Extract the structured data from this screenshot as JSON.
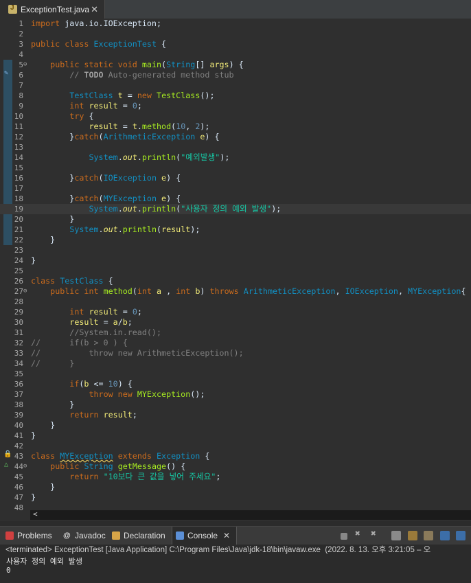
{
  "editor_tab": {
    "title": "ExceptionTest.java",
    "close": "✕"
  },
  "code_lines": [
    {
      "n": "1",
      "h": "<span class='kw'>import</span> java.io.IOException;"
    },
    {
      "n": "2",
      "h": ""
    },
    {
      "n": "3",
      "h": "<span class='kw'>public class</span> <span class='ty'>ExceptionTest</span> {"
    },
    {
      "n": "4",
      "h": ""
    },
    {
      "n": "5",
      "h": "    <span class='kw'>public static void</span> <span class='fn'>main</span>(<span class='ty'>String</span>[] <span class='va'>args</span>) {"
    },
    {
      "n": "6",
      "h": "        <span class='cm'>// <span class='todo'>TODO</span> Auto-generated method stub</span>"
    },
    {
      "n": "7",
      "h": ""
    },
    {
      "n": "8",
      "h": "        <span class='ty'>TestClass</span> <span class='va'>t</span> = <span class='kw'>new</span> <span class='fn'>TestClass</span>();"
    },
    {
      "n": "9",
      "h": "        <span class='kw'>int</span> <span class='va'>result</span> = <span class='nu'>0</span>;"
    },
    {
      "n": "10",
      "h": "        <span class='kw'>try</span> {"
    },
    {
      "n": "11",
      "h": "            <span class='va'>result</span> = <span class='va'>t</span>.<span class='fn'>method</span>(<span class='nu'>10</span>, <span class='nu'>2</span>);"
    },
    {
      "n": "12",
      "h": "        }<span class='kw'>catch</span>(<span class='ty'>ArithmeticException</span> <span class='va'>e</span>) {"
    },
    {
      "n": "13",
      "h": ""
    },
    {
      "n": "14",
      "h": "            <span class='ty'>System</span>.<i class='va'>out</i>.<span class='fn'>println</span>(<span class='st'>\"예외발생\"</span>);"
    },
    {
      "n": "15",
      "h": ""
    },
    {
      "n": "16",
      "h": "        }<span class='kw'>catch</span>(<span class='ty'>IOException</span> <span class='va'>e</span>) {"
    },
    {
      "n": "17",
      "h": ""
    },
    {
      "n": "18",
      "h": "        }<span class='kw'>catch</span>(<span class='ty'>MYException</span> <span class='va'>e</span>) {"
    },
    {
      "n": "19",
      "h": "            <span class='ty'>System</span>.<i class='va'>out</i>.<span class='fn'>println</span>(<span class='st'>\"사용자 정의 예외 발생\"</span>);"
    },
    {
      "n": "20",
      "h": "        }"
    },
    {
      "n": "21",
      "h": "        <span class='ty'>System</span>.<i class='va'>out</i>.<span class='fn'>println</span>(<span class='va'>result</span>);"
    },
    {
      "n": "22",
      "h": "    }"
    },
    {
      "n": "23",
      "h": ""
    },
    {
      "n": "24",
      "h": "}"
    },
    {
      "n": "25",
      "h": ""
    },
    {
      "n": "26",
      "h": "<span class='kw'>class</span> <span class='ty'>TestClass</span> {"
    },
    {
      "n": "27",
      "h": "    <span class='kw'>public int</span> <span class='fn'>method</span>(<span class='kw'>int</span> <span class='va'>a</span> , <span class='kw'>int</span> <span class='va'>b</span>) <span class='kw'>throws</span> <span class='ty'>ArithmeticException</span>, <span class='ty'>IOException</span>, <span class='ty'>MYException</span>{"
    },
    {
      "n": "28",
      "h": ""
    },
    {
      "n": "29",
      "h": "        <span class='kw'>int</span> <span class='va'>result</span> = <span class='nu'>0</span>;"
    },
    {
      "n": "30",
      "h": "        <span class='va'>result</span> = <span class='va'>a</span>/<span class='va'>b</span>;"
    },
    {
      "n": "31",
      "h": "        <span class='cm'>//System.in.read();</span>"
    },
    {
      "n": "32",
      "h": "<span class='cm'>//      if(b &gt; 0 ) {</span>"
    },
    {
      "n": "33",
      "h": "<span class='cm'>//          throw new ArithmeticException();</span>"
    },
    {
      "n": "34",
      "h": "<span class='cm'>//      }</span>"
    },
    {
      "n": "35",
      "h": ""
    },
    {
      "n": "36",
      "h": "        <span class='kw'>if</span>(<span class='va'>b</span> &lt;= <span class='nu'>10</span>) {"
    },
    {
      "n": "37",
      "h": "            <span class='kw'>throw new</span> <span class='fn'>MYException</span>();"
    },
    {
      "n": "38",
      "h": "        }"
    },
    {
      "n": "39",
      "h": "        <span class='kw'>return</span> <span class='va'>result</span>;"
    },
    {
      "n": "40",
      "h": "    }"
    },
    {
      "n": "41",
      "h": "}"
    },
    {
      "n": "42",
      "h": ""
    },
    {
      "n": "43",
      "h": "<span class='kw'>class</span> <span class='ty warn'>MYException</span> <span class='kw'>extends</span> <span class='ty'>Exception</span> {"
    },
    {
      "n": "44",
      "h": "    <span class='kw'>public</span> <span class='ty'>String</span> <span class='fn'>getMessage</span>() {"
    },
    {
      "n": "45",
      "h": "        <span class='kw'>return</span> <span class='st'>\"10보다 큰 값을 넣어 주세요\"</span>;"
    },
    {
      "n": "46",
      "h": "    }"
    },
    {
      "n": "47",
      "h": "}"
    },
    {
      "n": "48",
      "h": ""
    }
  ],
  "folded_lines": [
    "5",
    "27",
    "44"
  ],
  "highlighted_line": "19",
  "scroll_left": "<",
  "bottom_tabs": [
    {
      "label": "Problems",
      "icon": "problems-icon",
      "color": "#d04040"
    },
    {
      "label": "Javadoc",
      "icon": "javadoc-icon",
      "color": "#c0c0c0"
    },
    {
      "label": "Declaration",
      "icon": "declaration-icon",
      "color": "#d8a548"
    },
    {
      "label": "Console",
      "icon": "console-icon",
      "color": "#5b8fd6"
    }
  ],
  "console": {
    "title": "<terminated> ExceptionTest [Java Application] C:\\Program Files\\Java\\jdk-18\\bin\\javaw.exe  (2022. 8. 13. 오후 3:21:05 – 오",
    "output": [
      "사용자 정의 예외 발생",
      "0"
    ]
  },
  "colors": {
    "keyword": "#cc6c1d",
    "type": "#1290c3",
    "method": "#a7ec21",
    "string": "#17c6a3",
    "variable": "#f3ec79",
    "comment": "#808080"
  }
}
